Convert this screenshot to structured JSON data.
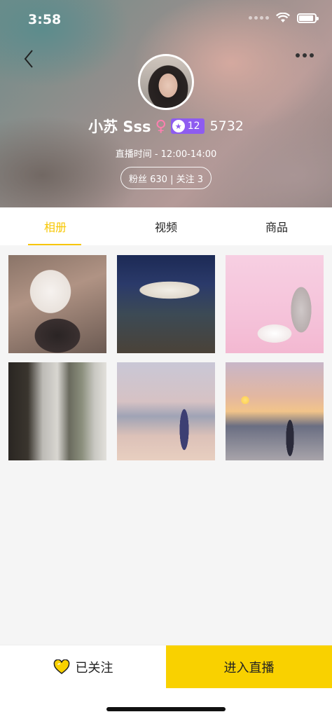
{
  "status_bar": {
    "time": "3:58"
  },
  "profile": {
    "name": "小苏  Sss",
    "gender_symbol": "♀",
    "level": "12",
    "score": "5732",
    "live_time": "直播时间 - 12:00-14:00",
    "fans_follow": "粉丝 630 | 关注 3"
  },
  "tabs": [
    {
      "label": "相册",
      "active": true
    },
    {
      "label": "视频",
      "active": false
    },
    {
      "label": "商品",
      "active": false
    }
  ],
  "album_photos": [
    "photo-dog",
    "photo-night-balcony",
    "photo-pink-cafe",
    "photo-curtain-window",
    "photo-beach-dusk",
    "photo-beach-sunset"
  ],
  "bottom_bar": {
    "follow_label": "已关注",
    "enter_live_label": "进入直播"
  },
  "colors": {
    "accent": "#f7c600",
    "enter_button": "#f9d100",
    "level_badge": "#8e5cf0",
    "gender": "#ff7fb0"
  }
}
